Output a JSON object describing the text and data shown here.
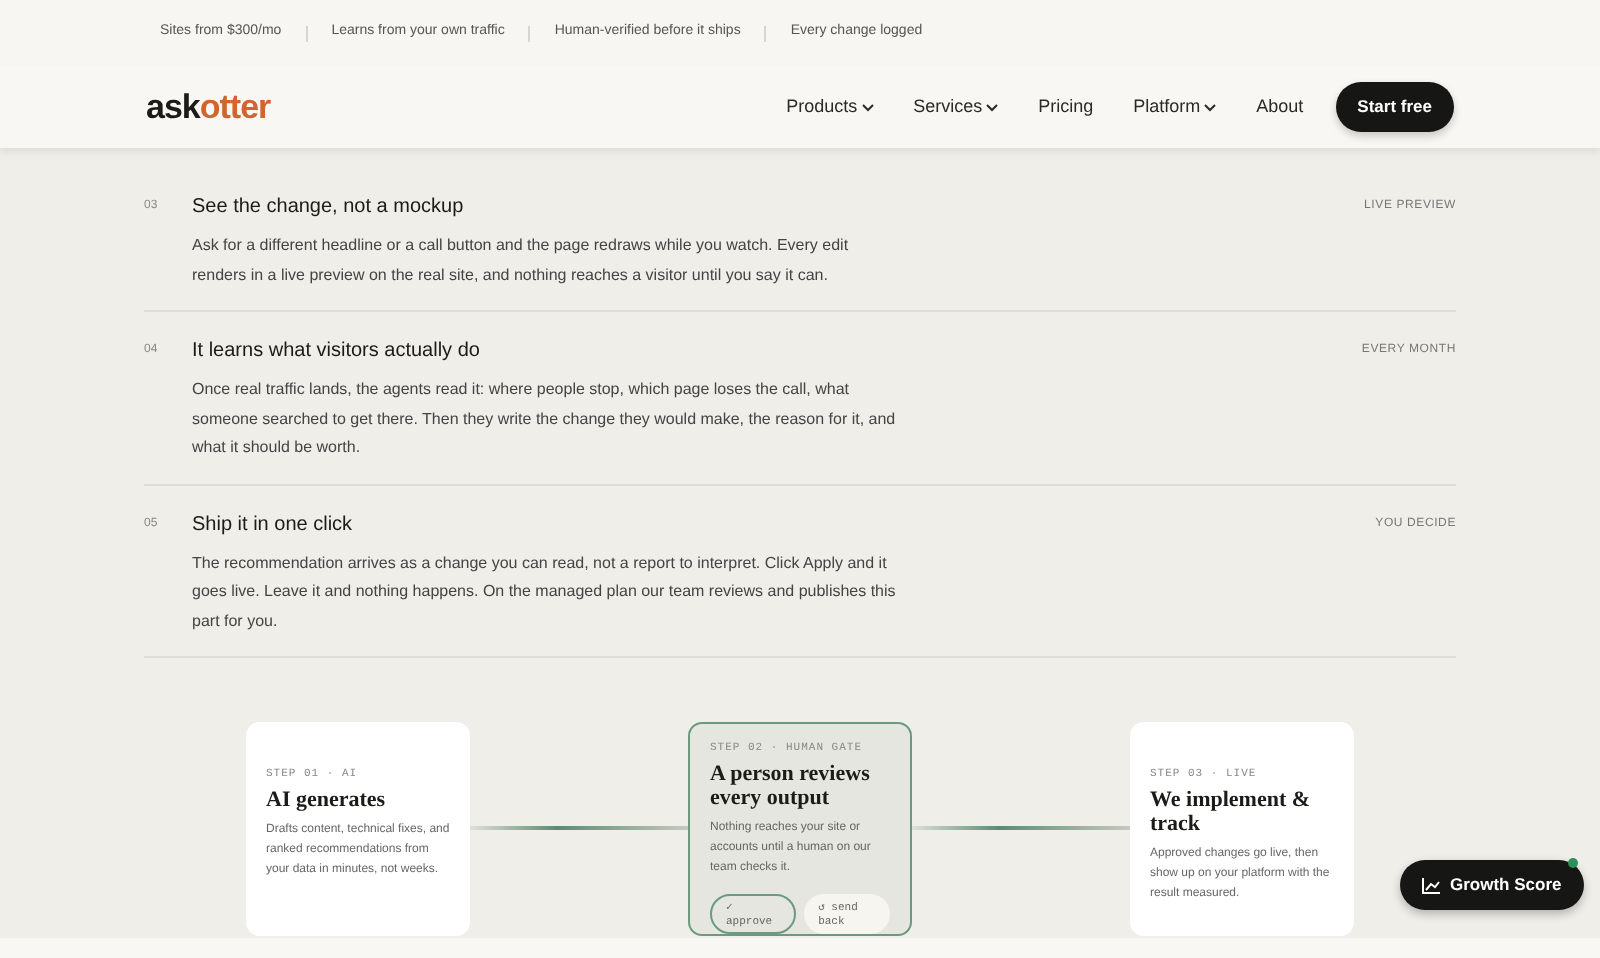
{
  "top_strip": [
    "Sites from $300/mo",
    "Learns from your own traffic",
    "Human-verified before it ships",
    "Every change logged"
  ],
  "navbar": {
    "logo": {
      "main": "ask",
      "accent": "otter"
    },
    "links": [
      {
        "label": "Products",
        "dropdown": true
      },
      {
        "label": "Services",
        "dropdown": true
      },
      {
        "label": "Pricing",
        "dropdown": false
      },
      {
        "label": "Platform",
        "dropdown": true
      },
      {
        "label": "About",
        "dropdown": false
      }
    ],
    "cta": "Start free"
  },
  "steps": [
    {
      "number": "03",
      "title": "See the change, not a mockup",
      "text": "Ask for a different headline or a call button and the page redraws while you watch. Every edit renders in a live preview on the real site, and nothing reaches a visitor until you say it can.",
      "tag": "LIVE PREVIEW"
    },
    {
      "number": "04",
      "title": "It learns what visitors actually do",
      "text": "Once real traffic lands, the agents read it: where people stop, which page loses the call, what someone searched to get there. Then they write the change they would make, the reason for it, and what it should be worth.",
      "tag": "EVERY MONTH"
    },
    {
      "number": "05",
      "title": "Ship it in one click",
      "text": "The recommendation arrives as a change you can read, not a report to interpret. Click Apply and it goes live. Leave it and nothing happens. On the managed plan our team reviews and publishes this part for you.",
      "tag": "YOU DECIDE"
    }
  ],
  "flow_cards": [
    {
      "label": "STEP 01 · AI",
      "title": "AI generates",
      "text": "Drafts content, technical fixes, and ranked recommendations from your data in minutes, not weeks.",
      "highlighted": false
    },
    {
      "label": "STEP 02 · HUMAN GATE",
      "title": "A person reviews every output",
      "text": "Nothing reaches your site or accounts until a human on our team checks it.",
      "highlighted": true,
      "actions": [
        {
          "label": "✓ approve",
          "kind": "outline"
        },
        {
          "label": "↺ send back",
          "kind": "soft"
        }
      ]
    },
    {
      "label": "STEP 03 · LIVE",
      "title": "We implement & track",
      "text": "Approved changes go live, then show up on your platform with the result measured.",
      "highlighted": false
    }
  ],
  "floating_button": {
    "label": "Growth Score",
    "notification": true
  }
}
